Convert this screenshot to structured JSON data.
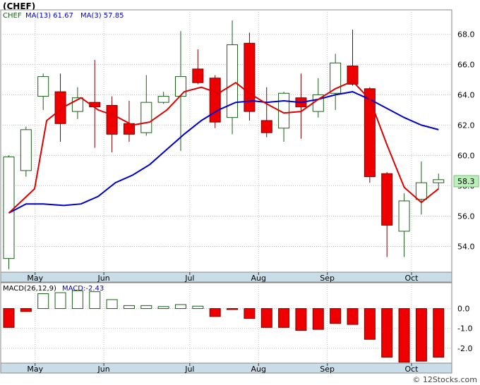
{
  "title": "(CHEF)",
  "footer": "© 12Stocks.com",
  "colors": {
    "up_fill": "#ffffff",
    "up_stroke": "#1a5e1a",
    "down_fill": "#ee0000",
    "down_stroke": "#7a0000",
    "wick": "#1a5e1a",
    "ma13": "#0000cc",
    "ma3": "#dd0000",
    "axis_bg": "#c8dde8",
    "grid": "#c0c0c0",
    "price_box": "#b8f0b8"
  },
  "chart_data": [
    {
      "type": "candlestick",
      "legend": [
        {
          "label": "CHEF",
          "value": ""
        },
        {
          "label": "MA(13)",
          "value": "61.67"
        },
        {
          "label": "MA(3)",
          "value": "57.85"
        }
      ],
      "ylim": [
        52.3,
        69.6
      ],
      "yticks": [
        54.0,
        56.0,
        58.0,
        60.0,
        62.0,
        64.0,
        66.0,
        68.0
      ],
      "ytick_labels": [
        "54.0",
        "56.0",
        "58.0",
        "60.0",
        "62.0",
        "64.0",
        "66.0",
        "68.0"
      ],
      "last_price_label": "58.3",
      "last_price": 58.3,
      "x_labels": [
        {
          "label": "May",
          "index": 1.2
        },
        {
          "label": "Jun",
          "index": 5.2
        },
        {
          "label": "Jul",
          "index": 10.2
        },
        {
          "label": "Aug",
          "index": 14.2
        },
        {
          "label": "Sep",
          "index": 18.2
        },
        {
          "label": "Oct",
          "index": 23.1
        }
      ],
      "candles": [
        {
          "o": 53.2,
          "h": 60.0,
          "l": 52.5,
          "c": 59.9
        },
        {
          "o": 59.0,
          "h": 61.9,
          "l": 58.6,
          "c": 61.7
        },
        {
          "o": 63.9,
          "h": 65.4,
          "l": 63.0,
          "c": 65.2
        },
        {
          "o": 64.2,
          "h": 65.4,
          "l": 60.9,
          "c": 62.1
        },
        {
          "o": 62.9,
          "h": 64.5,
          "l": 62.4,
          "c": 63.8
        },
        {
          "o": 63.5,
          "h": 66.3,
          "l": 60.5,
          "c": 63.2
        },
        {
          "o": 63.3,
          "h": 63.9,
          "l": 60.2,
          "c": 61.4
        },
        {
          "o": 62.1,
          "h": 63.6,
          "l": 60.9,
          "c": 61.4
        },
        {
          "o": 61.5,
          "h": 65.3,
          "l": 61.3,
          "c": 63.5
        },
        {
          "o": 63.5,
          "h": 64.2,
          "l": 63.4,
          "c": 63.9
        },
        {
          "o": 63.9,
          "h": 68.2,
          "l": 60.3,
          "c": 65.2
        },
        {
          "o": 65.7,
          "h": 67.0,
          "l": 64.7,
          "c": 64.8
        },
        {
          "o": 65.1,
          "h": 65.3,
          "l": 61.8,
          "c": 62.2
        },
        {
          "o": 62.5,
          "h": 68.9,
          "l": 61.4,
          "c": 67.3
        },
        {
          "o": 67.4,
          "h": 68.1,
          "l": 62.3,
          "c": 62.9
        },
        {
          "o": 62.3,
          "h": 64.5,
          "l": 61.2,
          "c": 61.5
        },
        {
          "o": 61.8,
          "h": 64.2,
          "l": 60.9,
          "c": 64.1
        },
        {
          "o": 63.8,
          "h": 65.4,
          "l": 61.1,
          "c": 63.2
        },
        {
          "o": 62.9,
          "h": 65.1,
          "l": 62.5,
          "c": 64.0
        },
        {
          "o": 64.1,
          "h": 66.7,
          "l": 63.0,
          "c": 66.1
        },
        {
          "o": 65.9,
          "h": 68.3,
          "l": 64.6,
          "c": 64.7
        },
        {
          "o": 64.4,
          "h": 64.5,
          "l": 58.2,
          "c": 58.6
        },
        {
          "o": 58.8,
          "h": 58.9,
          "l": 53.3,
          "c": 55.4
        },
        {
          "o": 55.0,
          "h": 57.5,
          "l": 53.3,
          "c": 57.0
        },
        {
          "o": 57.1,
          "h": 59.6,
          "l": 56.1,
          "c": 58.2
        },
        {
          "o": 58.2,
          "h": 58.8,
          "l": 57.8,
          "c": 58.4
        }
      ],
      "ma13": [
        56.2,
        58.4,
        62.3,
        63.1,
        63.7,
        null,
        null,
        62.0,
        62.2,
        63.0,
        64.2,
        64.4,
        64.8,
        64.3,
        64.8,
        63.4,
        62.8,
        62.9,
        63.6,
        64.6,
        64.9,
        62.7,
        59.5,
        57.2,
        56.6,
        57.9
      ],
      "ma13_full": [
        [
          0,
          56.2
        ],
        [
          1.5,
          57.8
        ],
        [
          2.2,
          62.3
        ],
        [
          3.2,
          63.2
        ],
        [
          4.2,
          63.8
        ],
        [
          5.2,
          63.0
        ],
        [
          6.2,
          62.6
        ],
        [
          7.2,
          62.0
        ],
        [
          8.2,
          62.2
        ],
        [
          9.2,
          63.0
        ],
        [
          10.2,
          64.2
        ],
        [
          11.2,
          64.5
        ],
        [
          12.2,
          64.1
        ],
        [
          13.2,
          64.8
        ],
        [
          14.0,
          64.1
        ],
        [
          15.0,
          63.4
        ],
        [
          16.0,
          62.8
        ],
        [
          17.0,
          62.9
        ],
        [
          18.0,
          63.7
        ],
        [
          19.0,
          64.4
        ],
        [
          20.0,
          64.9
        ],
        [
          21.0,
          63.7
        ],
        [
          22.0,
          60.7
        ],
        [
          23.0,
          57.9
        ],
        [
          24.0,
          56.9
        ],
        [
          25.0,
          57.8
        ]
      ],
      "ma3_full": [
        [
          0,
          56.2
        ],
        [
          1.0,
          56.8
        ],
        [
          2.0,
          56.8
        ],
        [
          3.2,
          56.7
        ],
        [
          4.2,
          56.8
        ],
        [
          5.2,
          57.3
        ],
        [
          6.2,
          58.2
        ],
        [
          7.2,
          58.7
        ],
        [
          8.2,
          59.4
        ],
        [
          9.2,
          60.4
        ],
        [
          10.2,
          61.4
        ],
        [
          11.2,
          62.3
        ],
        [
          12.2,
          63.0
        ],
        [
          13.2,
          63.5
        ],
        [
          14.2,
          63.6
        ],
        [
          15.0,
          63.5
        ],
        [
          16.0,
          63.6
        ],
        [
          17.0,
          63.5
        ],
        [
          18.0,
          63.7
        ],
        [
          19.0,
          64.0
        ],
        [
          20.0,
          64.2
        ],
        [
          21.0,
          63.7
        ],
        [
          22.0,
          63.1
        ],
        [
          23.0,
          62.5
        ],
        [
          24.0,
          62.0
        ],
        [
          25.0,
          61.7
        ]
      ],
      "ma_series_map": {
        "blue": "MA(3)",
        "red": "MA(13)"
      }
    },
    {
      "type": "bar",
      "legend": [
        {
          "label": "MACD(26,12,9)",
          "value": ""
        },
        {
          "label": "MACD:",
          "value": "-2.43"
        }
      ],
      "ylim": [
        -2.75,
        1.3
      ],
      "yticks": [
        0.0,
        -1.0,
        -2.0
      ],
      "ytick_labels": [
        "0.0",
        "-1.0",
        "-2.0"
      ],
      "x_labels": [
        {
          "label": "May",
          "index": 1.2
        },
        {
          "label": "Jun",
          "index": 5.2
        },
        {
          "label": "Jul",
          "index": 10.2
        },
        {
          "label": "Aug",
          "index": 14.2
        },
        {
          "label": "Sep",
          "index": 18.2
        },
        {
          "label": "Oct",
          "index": 23.1
        }
      ],
      "values": [
        -0.95,
        -0.15,
        0.75,
        0.8,
        0.9,
        0.85,
        0.45,
        0.15,
        0.15,
        0.1,
        0.2,
        0.12,
        -0.4,
        -0.05,
        -0.5,
        -0.95,
        -0.95,
        -1.1,
        -1.05,
        -0.75,
        -0.8,
        -1.55,
        -2.45,
        -2.7,
        -2.65,
        -2.45
      ]
    }
  ]
}
